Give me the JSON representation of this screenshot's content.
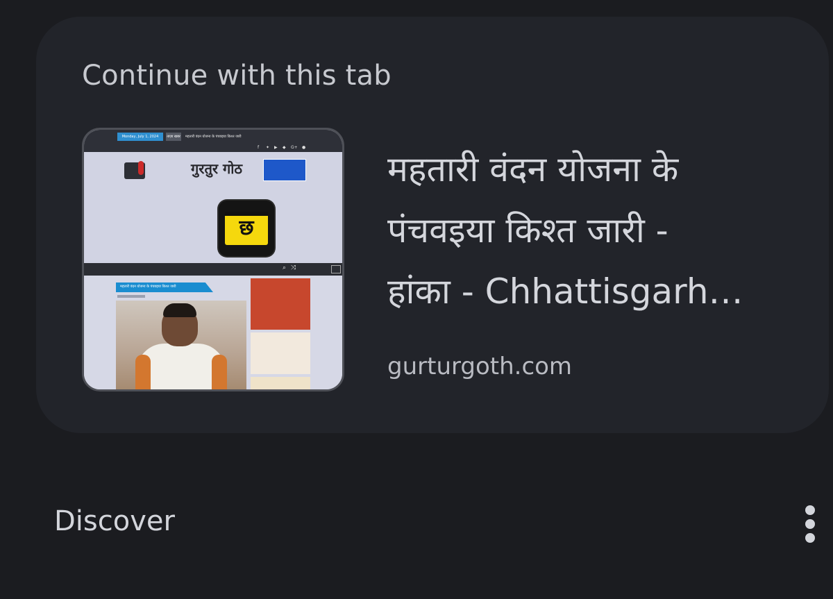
{
  "continue_card": {
    "title": "Continue with this tab",
    "article": {
      "title_lines": [
        "महतारी वंदन योजना के",
        "पंचवइया किश्त जारी -",
        "हांका - Chhattisgarh…"
      ],
      "domain": "gurturgoth.com"
    },
    "thumbnail": {
      "date_text": "Monday, July 1, 2024",
      "tag_text": "ताज़ा खबर",
      "headline_text": "महतारी वंदन योजना के पंचवइया किश्त जारी",
      "site_name": "गुरतुर गोठ",
      "article_header": "महतारी वंदन योजना के पंचवइया किश्त जारी",
      "favicon_icon": "chhattisgarhi-letter-icon",
      "favicon_glyph": "छ"
    }
  },
  "discover": {
    "label": "Discover",
    "menu_icon": "more-vert-icon"
  }
}
